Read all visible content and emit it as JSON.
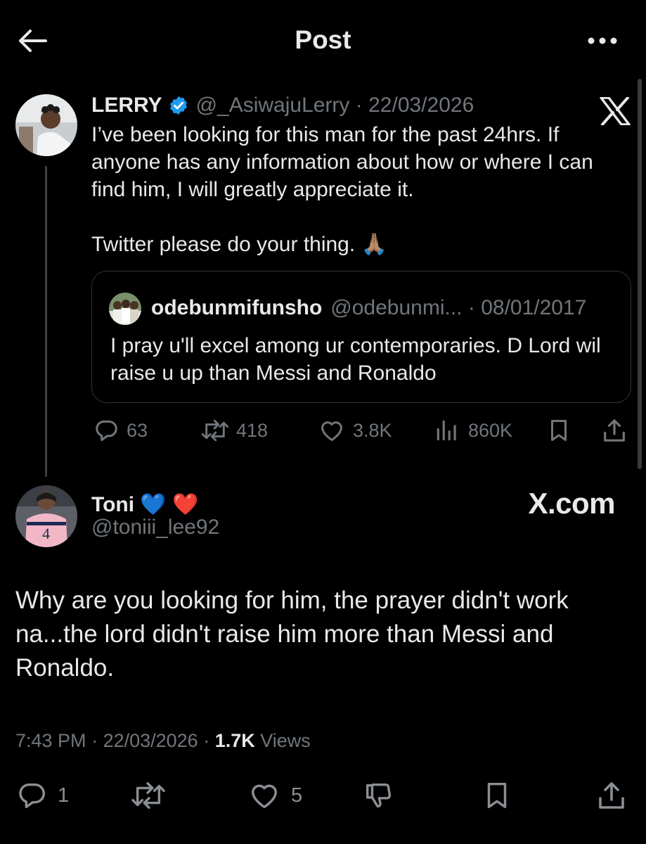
{
  "header": {
    "title": "Post"
  },
  "original_post": {
    "name": "LERRY",
    "handle": "@_AsiwajuLerry",
    "sep": " · ",
    "date": "22/03/2026",
    "body_1": "I’ve been looking for this man for the past 24hrs. If anyone has any information about how or where I can find him, I will greatly appreciate it.",
    "body_2": "Twitter please do your thing. 🙏🏽",
    "quote": {
      "name": "odebunmifunsho",
      "handle": "@odebunmi...",
      "sep": " · ",
      "date": "08/01/2017",
      "body": "I pray u'll excel among ur contemporaries. D Lord wil raise u up than Messi and Ronaldo"
    },
    "stats": {
      "replies": "63",
      "reposts": "418",
      "likes": "3.8K",
      "views": "860K"
    }
  },
  "reply_post": {
    "name": "Toni 💙 ❤️",
    "handle": "@toniii_lee92",
    "watermark": "X.com",
    "body": "Why are you looking for him, the prayer didn't work na...the lord didn't raise him more than Messi and Ronaldo.",
    "time": "7:43 PM",
    "date": "22/03/2026",
    "views_count": "1.7K",
    "views_label": "Views",
    "sep": " · ",
    "stats": {
      "replies": "1",
      "likes": "5"
    }
  },
  "colors": {
    "background": "#000000",
    "text": "#e7e9ea",
    "muted": "#71767b",
    "verified": "#1d9bf0",
    "border": "#2f3336"
  },
  "icons": [
    "back-arrow-icon",
    "more-icon",
    "verified-badge-icon",
    "x-logo-icon",
    "reply-icon",
    "repost-icon",
    "like-icon",
    "views-icon",
    "bookmark-icon",
    "share-icon",
    "dislike-icon"
  ]
}
